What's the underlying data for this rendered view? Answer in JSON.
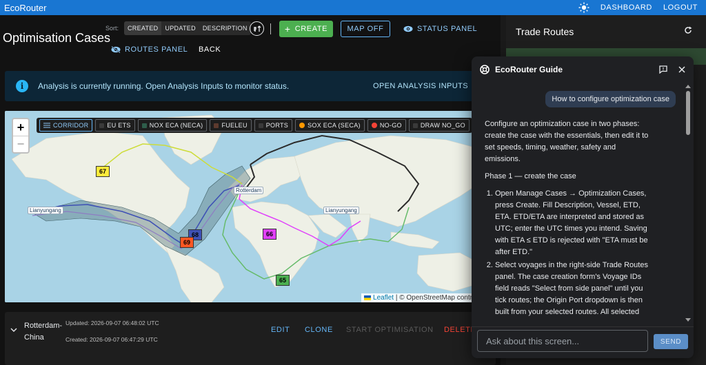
{
  "app": {
    "brand": "EcoRouter",
    "nav": [
      "DASHBOARD",
      "LOGOUT"
    ]
  },
  "page": {
    "title": "Optimisation Cases",
    "sort_label": "Sort:",
    "sort_options": [
      "CREATED",
      "UPDATED",
      "DESCRIPTION"
    ],
    "create_label": "CREATE",
    "map_off_label": "MAP OFF",
    "status_panel_label": "STATUS PANEL",
    "routes_panel_label": "ROUTES PANEL",
    "back_label": "BACK"
  },
  "banner": {
    "message": "Analysis is currently running. Open Analysis Inputs to monitor status.",
    "action": "OPEN ANALYSIS INPUTS"
  },
  "map": {
    "zoom_in": "+",
    "zoom_out": "−",
    "layers": [
      {
        "label": "CORRIDOR",
        "swatch": "#64b5f6",
        "kind": "icon",
        "active": true
      },
      {
        "label": "EU ETS",
        "swatch": "#3a3a3a",
        "kind": "square",
        "active": false
      },
      {
        "label": "NOX ECA (NECA)",
        "swatch": "#2e5d4a",
        "kind": "square",
        "active": false
      },
      {
        "label": "FUELEU",
        "swatch": "#5d3a2e",
        "kind": "square",
        "active": false
      },
      {
        "label": "PORTS",
        "swatch": "#3a3a3a",
        "kind": "square",
        "active": false
      },
      {
        "label": "SOX ECA (SECA)",
        "swatch": "#ff9800",
        "kind": "dot",
        "active": false
      },
      {
        "label": "NO-GO",
        "swatch": "#f44336",
        "kind": "dot",
        "active": false
      },
      {
        "label": "DRAW NO_GO",
        "swatch": "#3a3a3a",
        "kind": "square",
        "active": false
      }
    ],
    "ports": [
      "Lianyungang",
      "Rotterdam",
      "Lianyungang"
    ],
    "route_markers": [
      {
        "label": "67",
        "color": "#ffeb3b"
      },
      {
        "label": "68",
        "color": "#3f51b5"
      },
      {
        "label": "69",
        "color": "#ff5722"
      },
      {
        "label": "66",
        "color": "#e040fb"
      },
      {
        "label": "65",
        "color": "#4caf50"
      }
    ],
    "attribution_link": "Leaflet",
    "attribution_text": "| © OpenStreetMap contributors"
  },
  "case": {
    "name": "Rotterdam-China",
    "updated": "Updated: 2026-09-07 06:48:02 UTC",
    "created": "Created: 2026-09-07 06:47:29 UTC",
    "actions": [
      "EDIT",
      "CLONE",
      "START OPTIMISATION",
      "DELETE"
    ]
  },
  "trade_routes": {
    "title": "Trade Routes"
  },
  "guide": {
    "title": "EcoRouter Guide",
    "user_message": "How to configure optimization case",
    "intro": "Configure an optimization case in two phases: create the case with the essentials, then edit it to set speeds, timing, weather, safety and emissions.",
    "phase": "Phase 1 — create the case",
    "steps": [
      "Open Manage Cases → Optimization Cases, press Create. Fill Description, Vessel, ETD, ETA. ETD/ETA are interpreted and stored as UTC; enter the UTC times you intend. Saving with ETA ≤ ETD is rejected with \"ETA must be after ETD.\"",
      "Select voyages in the right-side Trade Routes panel. The case creation form's Voyage IDs field reads \"Select from side panel\" until you tick routes; the Origin Port dropdown is then built from your selected routes. All selected voyages must belong to"
    ],
    "input_placeholder": "Ask about this screen...",
    "send_label": "SEND"
  }
}
